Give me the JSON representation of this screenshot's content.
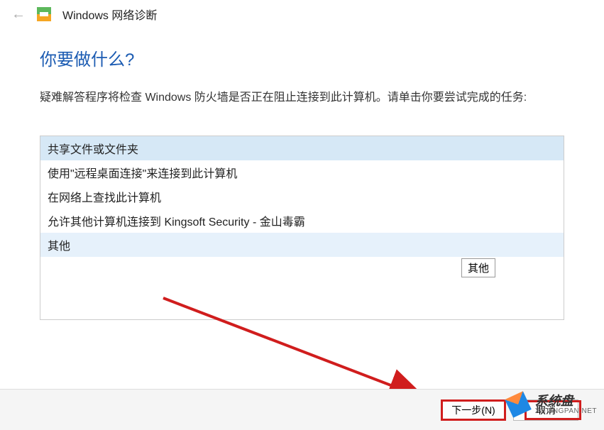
{
  "header": {
    "title": "Windows 网络诊断"
  },
  "main": {
    "question": "你要做什么?",
    "description": "疑难解答程序将检查 Windows 防火墙是否正在阻止连接到此计算机。请单击你要尝试完成的任务:"
  },
  "options": [
    {
      "label": "共享文件或文件夹",
      "selected": true,
      "highlight": false
    },
    {
      "label": "使用\"远程桌面连接\"来连接到此计算机",
      "selected": false,
      "highlight": false
    },
    {
      "label": "在网络上查找此计算机",
      "selected": false,
      "highlight": false
    },
    {
      "label": "允许其他计算机连接到 Kingsoft Security - 金山毒霸",
      "selected": false,
      "highlight": false
    },
    {
      "label": "其他",
      "selected": false,
      "highlight": true
    }
  ],
  "tooltip": "其他",
  "footer": {
    "next": "下一步(N)",
    "cancel": "取消"
  },
  "watermark": {
    "cn": "系统盘",
    "en": "XITONGPAN.NET"
  }
}
